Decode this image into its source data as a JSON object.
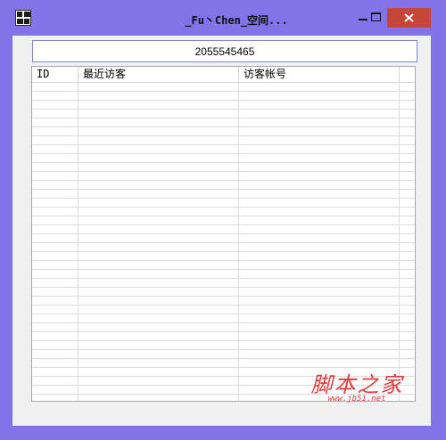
{
  "window": {
    "title": "_Fu丶Chen_空间...",
    "buttons": {
      "minimize": "minimize",
      "maximize": "maximize",
      "close": "close"
    },
    "colors": {
      "frame": "#8472e8",
      "close": "#c6463a",
      "client": "#f0f0f0"
    }
  },
  "qq_input": {
    "value": "2055545465"
  },
  "table": {
    "columns": [
      "ID",
      "最近访客",
      "访客帐号"
    ],
    "rows": []
  },
  "watermark": {
    "text": "脚本之家",
    "url": "www.jb51.net",
    "color": "#e0393c"
  }
}
